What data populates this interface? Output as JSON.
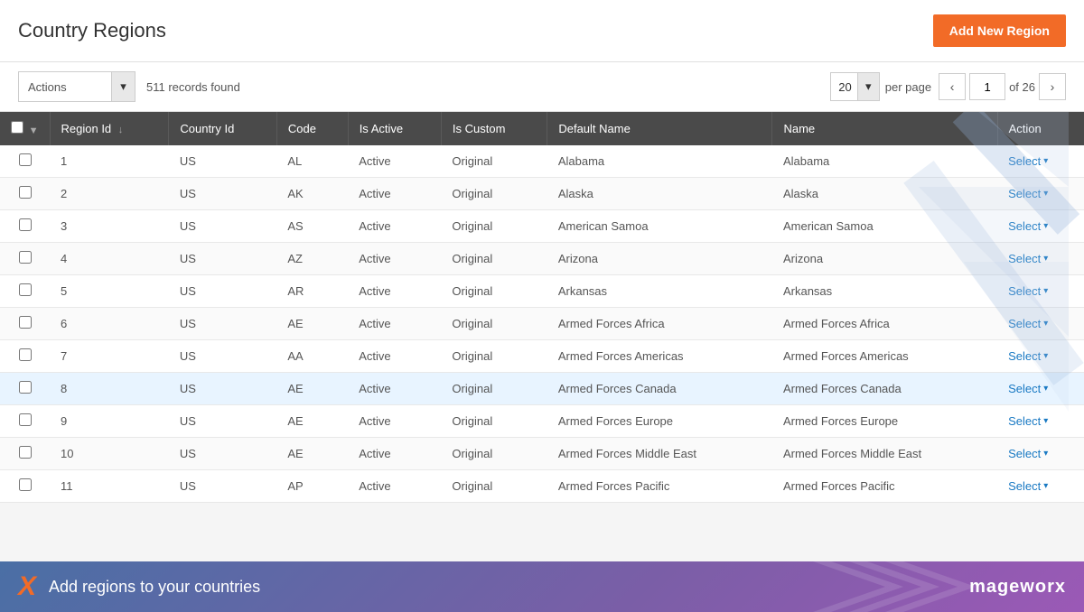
{
  "header": {
    "title": "Country Regions",
    "add_button_label": "Add New Region"
  },
  "toolbar": {
    "actions_label": "Actions",
    "records_count": "511 records found",
    "per_page_value": "20",
    "per_page_label": "per page",
    "current_page": "1",
    "total_pages": "26"
  },
  "table": {
    "columns": [
      {
        "id": "checkbox",
        "label": "",
        "sortable": false
      },
      {
        "id": "region_id",
        "label": "Region Id",
        "sortable": true
      },
      {
        "id": "country_id",
        "label": "Country Id",
        "sortable": false
      },
      {
        "id": "code",
        "label": "Code",
        "sortable": false
      },
      {
        "id": "is_active",
        "label": "Is Active",
        "sortable": false
      },
      {
        "id": "is_custom",
        "label": "Is Custom",
        "sortable": false
      },
      {
        "id": "default_name",
        "label": "Default Name",
        "sortable": false
      },
      {
        "id": "name",
        "label": "Name",
        "sortable": false
      },
      {
        "id": "action",
        "label": "Action",
        "sortable": false
      }
    ],
    "rows": [
      {
        "id": 1,
        "country_id": "US",
        "code": "AL",
        "is_active": "Active",
        "is_custom": "Original",
        "default_name": "Alabama",
        "name": "Alabama",
        "highlighted": false
      },
      {
        "id": 2,
        "country_id": "US",
        "code": "AK",
        "is_active": "Active",
        "is_custom": "Original",
        "default_name": "Alaska",
        "name": "Alaska",
        "highlighted": false
      },
      {
        "id": 3,
        "country_id": "US",
        "code": "AS",
        "is_active": "Active",
        "is_custom": "Original",
        "default_name": "American Samoa",
        "name": "American Samoa",
        "highlighted": false
      },
      {
        "id": 4,
        "country_id": "US",
        "code": "AZ",
        "is_active": "Active",
        "is_custom": "Original",
        "default_name": "Arizona",
        "name": "Arizona",
        "highlighted": false
      },
      {
        "id": 5,
        "country_id": "US",
        "code": "AR",
        "is_active": "Active",
        "is_custom": "Original",
        "default_name": "Arkansas",
        "name": "Arkansas",
        "highlighted": false
      },
      {
        "id": 6,
        "country_id": "US",
        "code": "AE",
        "is_active": "Active",
        "is_custom": "Original",
        "default_name": "Armed Forces Africa",
        "name": "Armed Forces Africa",
        "highlighted": false
      },
      {
        "id": 7,
        "country_id": "US",
        "code": "AA",
        "is_active": "Active",
        "is_custom": "Original",
        "default_name": "Armed Forces Americas",
        "name": "Armed Forces Americas",
        "highlighted": false
      },
      {
        "id": 8,
        "country_id": "US",
        "code": "AE",
        "is_active": "Active",
        "is_custom": "Original",
        "default_name": "Armed Forces Canada",
        "name": "Armed Forces Canada",
        "highlighted": true
      },
      {
        "id": 9,
        "country_id": "US",
        "code": "AE",
        "is_active": "Active",
        "is_custom": "Original",
        "default_name": "Armed Forces Europe",
        "name": "Armed Forces Europe",
        "highlighted": false
      },
      {
        "id": 10,
        "country_id": "US",
        "code": "AE",
        "is_active": "Active",
        "is_custom": "Original",
        "default_name": "Armed Forces Middle East",
        "name": "Armed Forces Middle East",
        "highlighted": false
      },
      {
        "id": 11,
        "country_id": "US",
        "code": "AP",
        "is_active": "Active",
        "is_custom": "Original",
        "default_name": "Armed Forces Pacific",
        "name": "Armed Forces Pacific",
        "highlighted": false
      }
    ],
    "select_label": "Select"
  },
  "footer": {
    "text": "Add regions to your countries",
    "brand": "mageworx",
    "x_icon": "X"
  }
}
